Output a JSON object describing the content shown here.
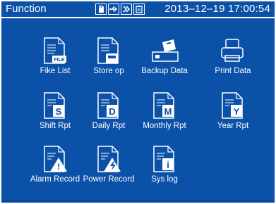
{
  "header": {
    "title": "Function",
    "datetime": "2013–12–19 17:00:54",
    "status_icons": [
      "sd-card-icon",
      "usb-icon",
      "forward-icon",
      "clipboard-icon"
    ]
  },
  "menu": {
    "items": [
      {
        "label": "Fike List",
        "icon": "file-list-icon",
        "badge": "FILE"
      },
      {
        "label": "Store op",
        "icon": "store-op-icon"
      },
      {
        "label": "Backup Data",
        "icon": "backup-data-icon"
      },
      {
        "label": "Print Data",
        "icon": "printer-icon"
      },
      {
        "label": "Shift Rpt",
        "icon": "shift-report-icon",
        "badge": "S"
      },
      {
        "label": "Daily Rpt",
        "icon": "daily-report-icon",
        "badge": "D"
      },
      {
        "label": "Monthly Rpt",
        "icon": "monthly-report-icon",
        "badge": "M"
      },
      {
        "label": "Year Rpt",
        "icon": "year-report-icon",
        "badge": "Y"
      },
      {
        "label": "Alarm Record",
        "icon": "alarm-record-icon",
        "badge": "!"
      },
      {
        "label": "Power Record",
        "icon": "power-record-icon"
      },
      {
        "label": "Sys log",
        "icon": "sys-log-icon",
        "badge": "i"
      }
    ]
  },
  "colors": {
    "panel": "#0b51a8",
    "text": "#ffffff"
  }
}
